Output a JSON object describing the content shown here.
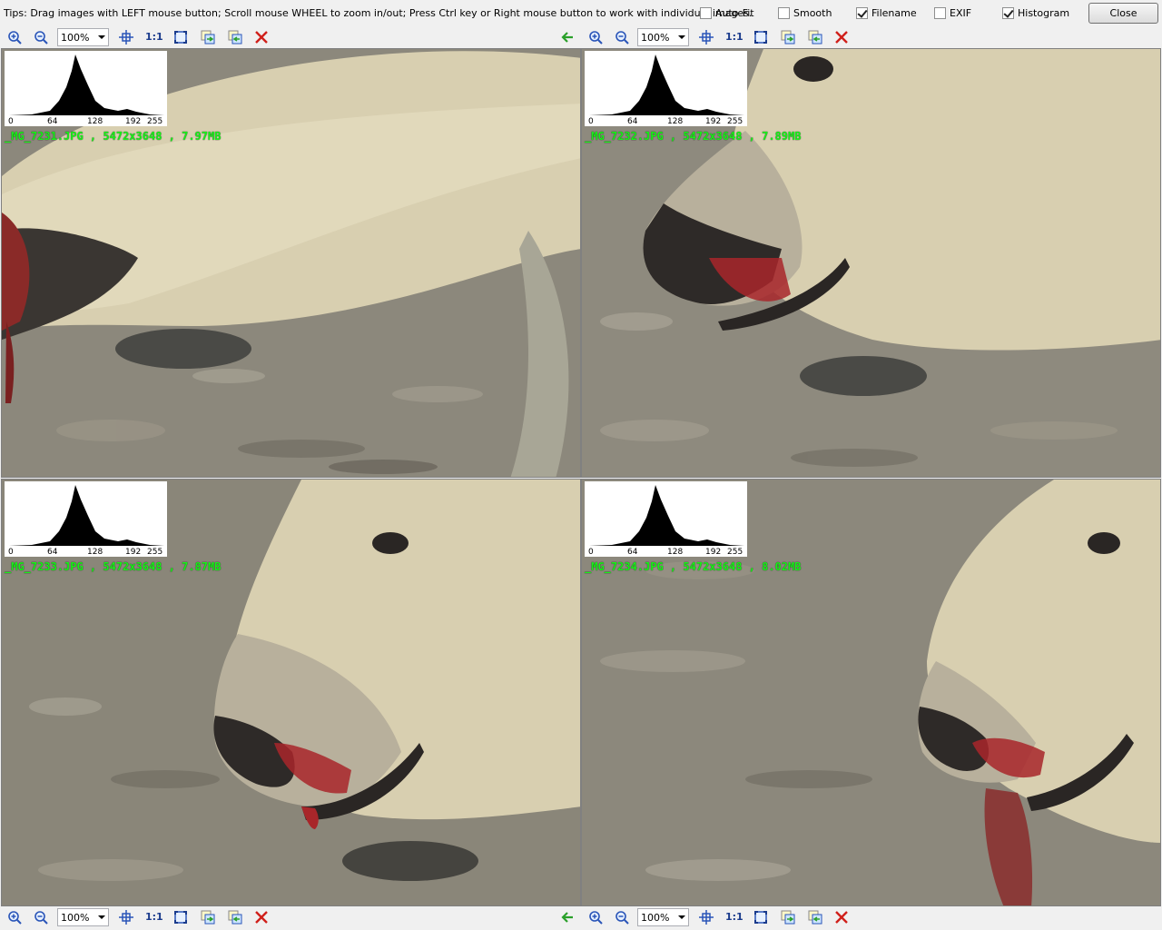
{
  "tips": "Tips: Drag images with LEFT mouse button; Scroll mouse WHEEL to zoom in/out; Press Ctrl key or Right mouse button to work with individual images.",
  "options": [
    {
      "label": "Auto-Fit",
      "checked": false
    },
    {
      "label": "Smooth",
      "checked": false
    },
    {
      "label": "Filename",
      "checked": true
    },
    {
      "label": "EXIF",
      "checked": false
    },
    {
      "label": "Histogram",
      "checked": true
    }
  ],
  "close_label": "Close",
  "toolbar": {
    "zoom": "100%",
    "one_to_one": "1:1",
    "icons": [
      "zoom-in-icon",
      "zoom-out-icon",
      "fit-center-icon",
      "actual-size-icon",
      "fit-window-icon",
      "sync-left-icon",
      "sync-right-icon",
      "close-image-icon",
      "back-arrow-icon"
    ]
  },
  "hist_ticks": [
    "0",
    "64",
    "128",
    "192",
    "255"
  ],
  "images": [
    {
      "filename": "_MG_7231.JPG",
      "dims": "5472x3648",
      "size": "7.97MB"
    },
    {
      "filename": "_MG_7232.JPG",
      "dims": "5472x3648",
      "size": "7.89MB"
    },
    {
      "filename": "_MG_7233.JPG",
      "dims": "5472x3648",
      "size": "7.87MB"
    },
    {
      "filename": "_MG_7234.JPG",
      "dims": "5472x3648",
      "size": "8.02MB"
    }
  ],
  "colors": {
    "filename_text": "#19f019",
    "fur": "#d8cfb0",
    "gravel": "#8a8679",
    "blood": "#a8262a",
    "close_x": "#d0201a",
    "arrow_green": "#2aa02a"
  }
}
